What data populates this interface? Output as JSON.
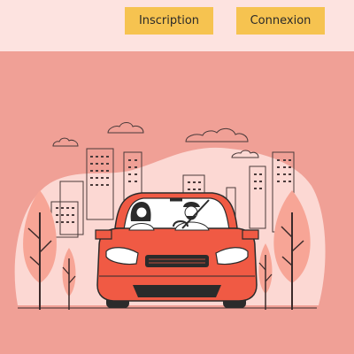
{
  "header": {
    "signup_label": "Inscription",
    "login_label": "Connexion"
  },
  "colors": {
    "header_bg": "#fde3e0",
    "button_bg": "#f6c350",
    "hero_bg": "#f0a096",
    "car_body": "#f05a44",
    "blob": "#fcd8d3"
  },
  "hero": {
    "illustration": "couple-driving-red-car-city-illustration"
  }
}
